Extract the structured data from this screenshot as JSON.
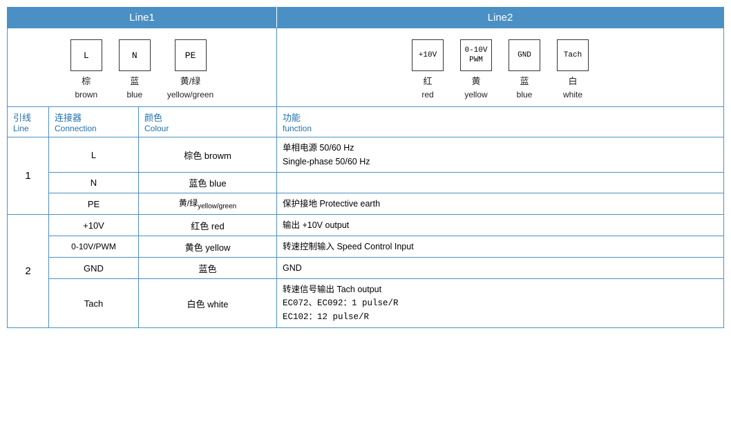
{
  "header": {
    "line1": "Line1",
    "line2": "Line2"
  },
  "diagram": {
    "line1": {
      "connectors": [
        {
          "id": "L",
          "label_zh": "棕",
          "label_en": "brown"
        },
        {
          "id": "N",
          "label_zh": "蓝",
          "label_en": "blue"
        },
        {
          "id": "PE",
          "label_zh": "黄/绿",
          "label_en": "yellow/green"
        }
      ]
    },
    "line2": {
      "connectors": [
        {
          "id": "+10V",
          "label_zh": "红",
          "label_en": "red"
        },
        {
          "id": "0-10V\nPWM",
          "label_zh": "黄",
          "label_en": "yellow"
        },
        {
          "id": "GND",
          "label_zh": "蓝",
          "label_en": "blue"
        },
        {
          "id": "Tach",
          "label_zh": "白",
          "label_en": "white"
        }
      ]
    }
  },
  "table": {
    "col_headers": {
      "line_zh": "引线",
      "line_en": "Line",
      "connection_zh": "连接器",
      "connection_en": "Connection",
      "colour_zh": "颜色",
      "colour_en": "Colour",
      "function_zh": "功能",
      "function_en": "function"
    },
    "rows": [
      {
        "line": "1",
        "rowspan": 3,
        "sub_rows": [
          {
            "connector": "L",
            "colour": "棕色 browm",
            "function": "单相电源 50/60 Hz\nSingle-phase 50/60 Hz"
          },
          {
            "connector": "N",
            "colour": "蓝色 blue",
            "function": ""
          },
          {
            "connector": "PE",
            "colour": "黄/绿 yellow/green",
            "function": "保护接地 Protective earth"
          }
        ]
      },
      {
        "line": "2",
        "rowspan": 4,
        "sub_rows": [
          {
            "connector": "+10V",
            "colour": "红色 red",
            "function": "输出 +10V output"
          },
          {
            "connector": "0-10V/PWM",
            "colour": "黄色 yellow",
            "function": "转速控制输入 Speed Control Input"
          },
          {
            "connector": "GND",
            "colour": "蓝色",
            "function": "GND"
          },
          {
            "connector": "Tach",
            "colour": "白色 white",
            "function": "转速信号输出 Tach output\nEC072、EC092：1 pulse/R\nEC102：12 pulse/R"
          }
        ]
      }
    ]
  }
}
